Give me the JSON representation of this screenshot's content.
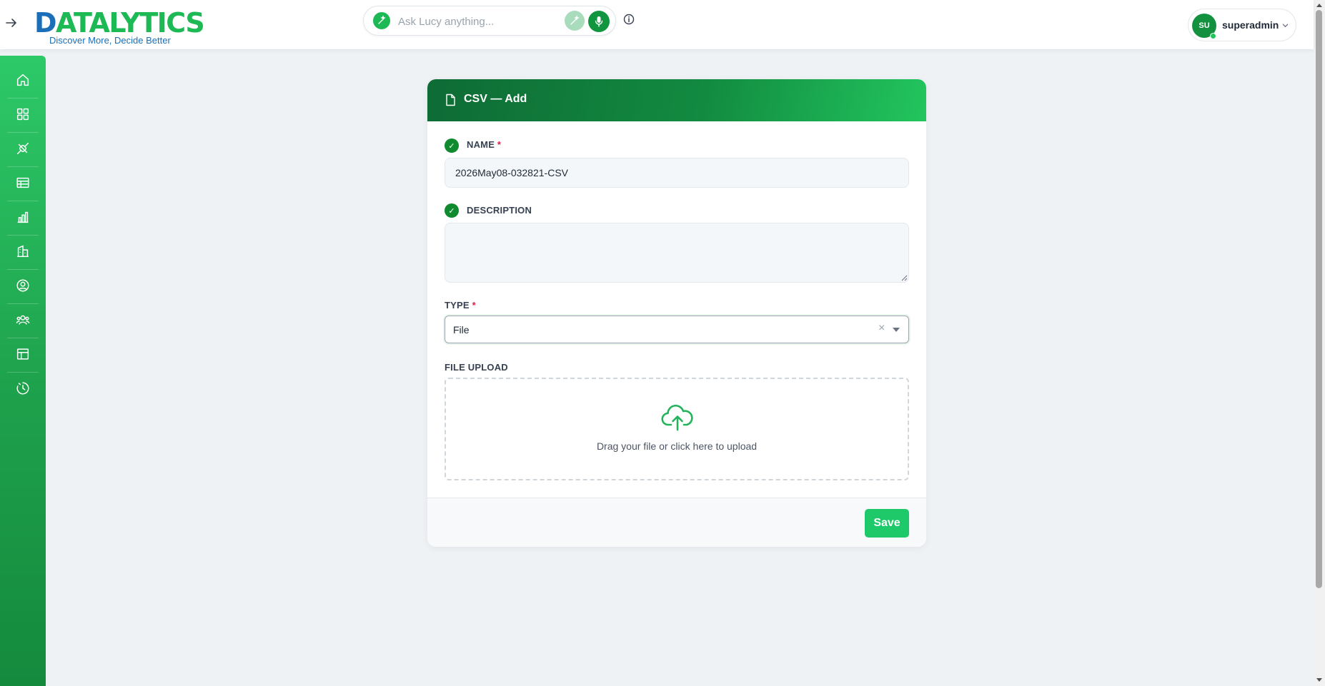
{
  "app": {
    "logo_text": "DATALYTICS",
    "logo_tagline": "Discover More, Decide Better",
    "brand_green": "#1db954",
    "brand_blue": "#1a6fb8"
  },
  "header": {
    "search_placeholder": "Ask Lucy anything...",
    "user": {
      "initials": "SU",
      "name": "superadmin"
    }
  },
  "sidebar": {
    "items": [
      {
        "name": "home",
        "icon": "home-icon"
      },
      {
        "name": "dashboards",
        "icon": "grid-icon"
      },
      {
        "name": "connectors",
        "icon": "plug-icon"
      },
      {
        "name": "tables",
        "icon": "table-icon"
      },
      {
        "name": "charts",
        "icon": "bar-chart-icon"
      },
      {
        "name": "organizations",
        "icon": "building-icon"
      },
      {
        "name": "profile",
        "icon": "user-circle-icon"
      },
      {
        "name": "teams",
        "icon": "users-icon"
      },
      {
        "name": "layouts",
        "icon": "layout-icon"
      },
      {
        "name": "history",
        "icon": "history-icon"
      }
    ]
  },
  "form": {
    "title": "CSV — Add",
    "name": {
      "label": "NAME",
      "required_mark": "*",
      "value": "2026May08-032821-CSV"
    },
    "description": {
      "label": "DESCRIPTION",
      "value": ""
    },
    "type": {
      "label": "TYPE",
      "required_mark": "*",
      "value": "File",
      "clear": "×"
    },
    "file_upload": {
      "label": "FILE UPLOAD",
      "hint": "Drag your file or click here to upload"
    },
    "check_mark": "✓",
    "save_label": "Save"
  }
}
